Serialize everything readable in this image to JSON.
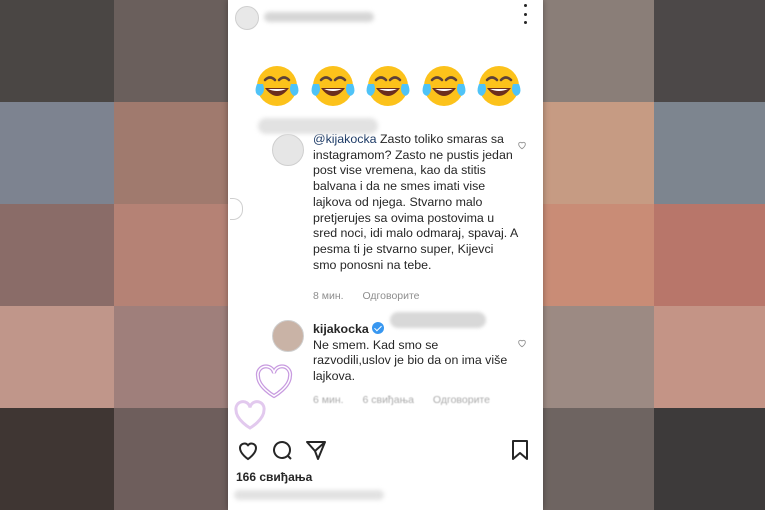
{
  "colors": {
    "accent": "#3897f0",
    "text": "#262626",
    "meta": "#8e8e8e",
    "mention": "#1c3a66",
    "heart_deco": "#c89be0"
  },
  "post": {
    "emoji_icons": [
      "tears-of-joy-emoji",
      "tears-of-joy-emoji",
      "tears-of-joy-emoji",
      "tears-of-joy-emoji",
      "tears-of-joy-emoji"
    ],
    "likes": "166 свиђања"
  },
  "comments": [
    {
      "mention": "@kijakocka",
      "text": " Zasto toliko smaras sa instagramom? Zasto ne pustis jedan post vise vremena, kao da stitis balvana i da ne smes imati vise lajkova od njega. Stvarno malo pretjerujes sa ovima postovima u sred noci, idi malo odmaraj, spavaj. A pesma ti je stvarno super, Kijevci smo ponosni na tebe.",
      "time": "8 мин.",
      "reply": "Одговорите"
    },
    {
      "username": "kijakocka",
      "text": "Ne smem. Kad smo se razvodili,uslov je bio da on ima više lajkova.",
      "time": "6 мин.",
      "likes": "6 свиђања",
      "reply": "Одговорите"
    }
  ]
}
